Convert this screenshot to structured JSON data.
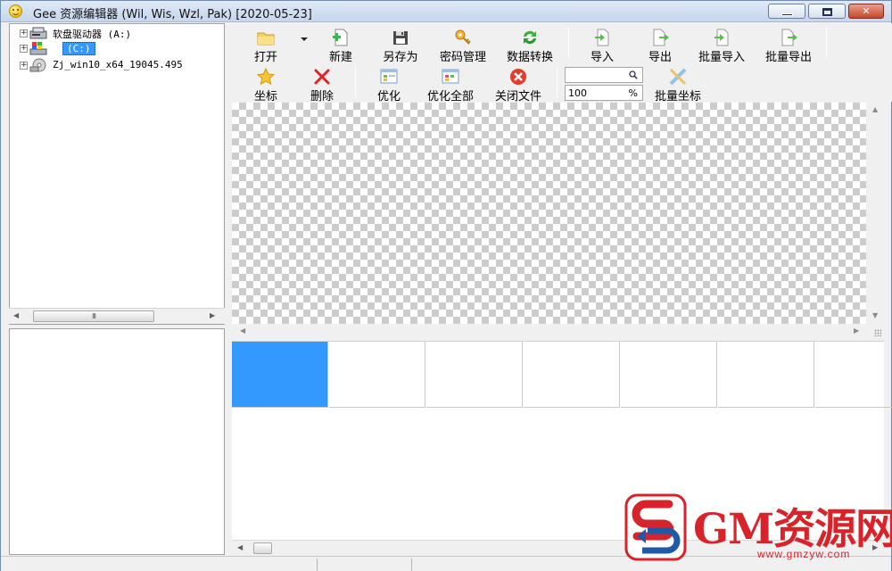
{
  "window": {
    "title": "Gee 资源编辑器 (Wil, Wis, Wzl, Pak) [2020-05-23]",
    "buttons": {
      "minimize": "minimize-icon",
      "maximize": "maximize-icon",
      "close": "close-icon",
      "close_glyph": "✕"
    }
  },
  "tree": {
    "items": [
      {
        "label": "软盘驱动器 (A:)",
        "icon": "floppy-drive-icon",
        "expander": "+"
      },
      {
        "label": "(C:)",
        "icon": "windows-drive-icon",
        "expander": "+",
        "selected": true
      },
      {
        "label": "Zj_win10_x64_19045.495",
        "icon": "optical-drive-icon",
        "expander": "+"
      }
    ],
    "scroll_arrows": {
      "left": "◀",
      "right": "▶"
    },
    "scroll_grip": "III"
  },
  "toolbar": {
    "row1": [
      {
        "label": "打开",
        "icon": "folder-open-icon"
      },
      {
        "label": "新建",
        "icon": "new-file-icon"
      },
      {
        "label": "另存为",
        "icon": "save-as-icon"
      },
      {
        "label": "密码管理",
        "icon": "key-icon"
      },
      {
        "label": "数据转换",
        "icon": "convert-icon"
      },
      {
        "label": "导入",
        "icon": "import-icon"
      },
      {
        "label": "导出",
        "icon": "export-icon"
      },
      {
        "label": "批量导入",
        "icon": "batch-import-icon"
      },
      {
        "label": "批量导出",
        "icon": "batch-export-icon"
      }
    ],
    "row2": [
      {
        "label": "坐标",
        "icon": "star-icon"
      },
      {
        "label": "删除",
        "icon": "delete-icon"
      },
      {
        "label": "优化",
        "icon": "optimize-icon"
      },
      {
        "label": "优化全部",
        "icon": "optimize-all-icon"
      },
      {
        "label": "关闭文件",
        "icon": "close-file-icon"
      },
      {
        "label": "批量坐标",
        "icon": "batch-coordinates-icon"
      }
    ],
    "search": {
      "value": "",
      "icon_glyph": "🔍"
    },
    "zoom": {
      "value": "100",
      "unit": "%"
    }
  },
  "canvas": {
    "scroll_up": "▲",
    "scroll_down": "▼",
    "scroll_left": "◀",
    "scroll_right": "▶"
  },
  "frames": {
    "count": 7,
    "selected_index": 0
  },
  "watermark": {
    "brand": "GM资源网",
    "url": "www.gmzyw.com"
  },
  "colors": {
    "selection": "#3399ff",
    "watermark_red": "#d8232a",
    "watermark_blue": "#1f5aa8"
  }
}
